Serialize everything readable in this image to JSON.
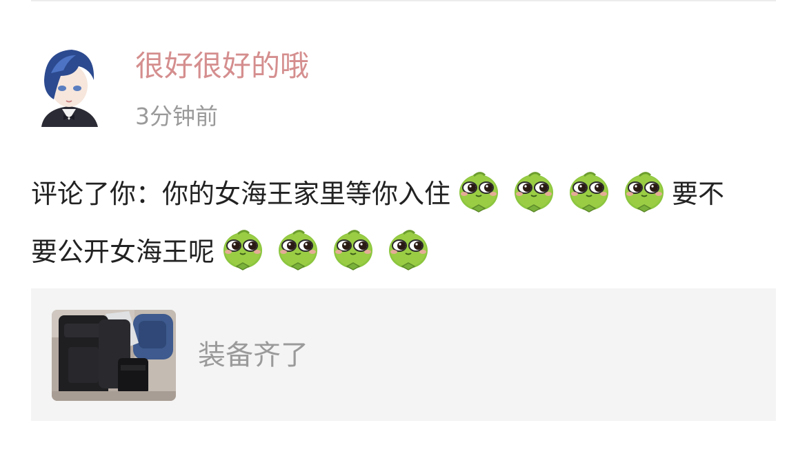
{
  "comment": {
    "username": "很好很好的哦",
    "time": "3分钟前",
    "line1_text": "评论了你：你的女海王家里等你入住",
    "line1_tail": "要不",
    "line2_text": "要公开女海王呢",
    "emoji_name": "green-bean-emoji",
    "accent_color": "#d58e8e"
  },
  "quoted_post": {
    "text": "装备齐了"
  }
}
